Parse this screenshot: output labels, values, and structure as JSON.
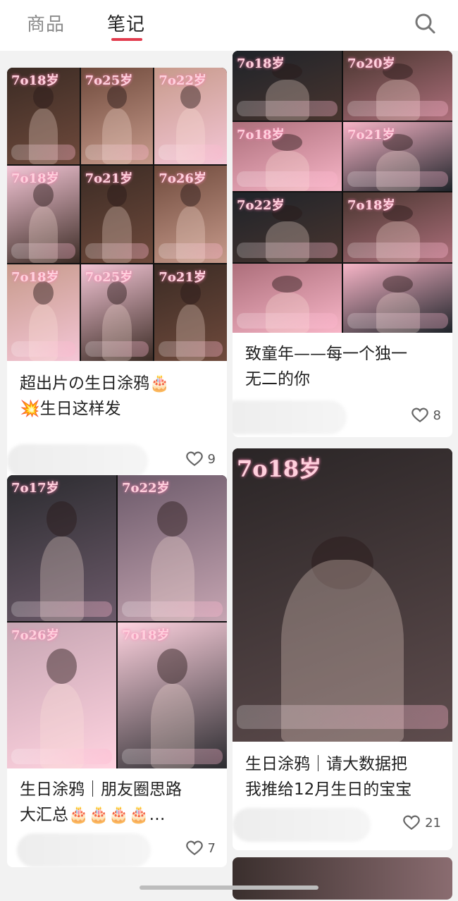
{
  "header": {
    "tabs": [
      {
        "label": "商品",
        "active": false
      },
      {
        "label": "笔记",
        "active": true
      }
    ],
    "accent_color": "#e23b4d"
  },
  "notes": [
    {
      "title_lines": [
        "超出片の生日涂鸦🎂",
        "💥生日这样发"
      ],
      "likes": "9",
      "palette": [
        "#3b2b24",
        "#6f4a3c",
        "#c79a8b",
        "#f4c6d6"
      ]
    },
    {
      "title_lines": [
        "致童年——每一个独一",
        "无二的你"
      ],
      "likes": "8",
      "palette": [
        "#1e2329",
        "#49352f",
        "#ad6f7b",
        "#f7b5c7"
      ]
    },
    {
      "title_lines": [
        "生日涂鸦｜朋友圈思路",
        "大汇总🎂🎂🎂🎂…"
      ],
      "likes": "7",
      "palette": [
        "#2b2b2f",
        "#6c5a6a",
        "#c6a5b2",
        "#ffd3e0"
      ]
    },
    {
      "title_lines": [
        "生日涂鸦｜请大数据把",
        "我推给12月生日的宝宝"
      ],
      "likes": "21",
      "palette": [
        "#2a2526",
        "#5e4c4d",
        "#d7b8bd",
        "#ff9fb8"
      ]
    }
  ],
  "cover_labels": {
    "a": [
      "7o18岁",
      "7o25岁",
      "7o22岁",
      "7o18岁",
      "7o21岁",
      "7o26岁",
      "7o18岁",
      "7o25岁",
      "7o21岁"
    ],
    "b": [
      "7o18岁",
      "7o20岁",
      "7o18岁",
      "7o21岁",
      "7o22岁",
      "7o18岁"
    ],
    "c": [
      "7o17岁",
      "7o22岁",
      "7o26岁",
      "7o18岁"
    ],
    "d": [
      "7o18岁"
    ]
  }
}
